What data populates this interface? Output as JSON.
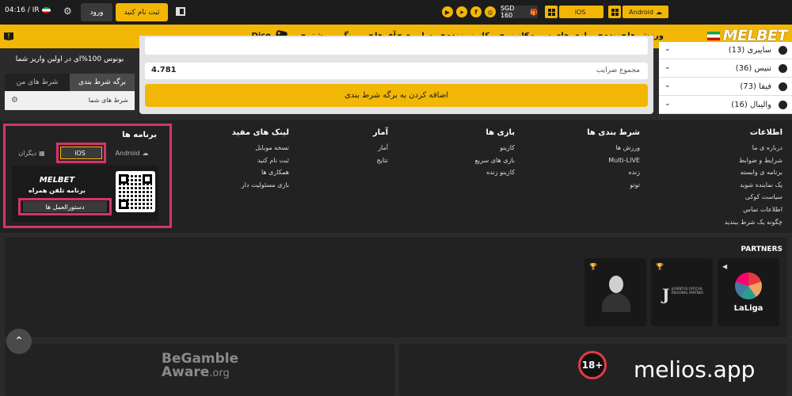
{
  "topbar": {
    "time": "04:16 / IR",
    "login": "ورود",
    "register": "ثبت نام کنید",
    "balance": "SGD 160",
    "ios": "iOS",
    "android": "Android",
    "social_icons": [
      "youtube-icon",
      "telegram-icon",
      "facebook-icon",
      "instagram-icon"
    ]
  },
  "nav": {
    "logo": "MELBET",
    "items": [
      "ورزش ها",
      "زنده",
      "بازی های سریع",
      "کازینو",
      "کازینو زنده",
      "سایبری",
      "آفرها",
      "بینگو",
      "بیشتر",
      "Dice"
    ]
  },
  "left": {
    "bonus": "بونوس 100%ای در اولین واریز شما",
    "tab_slip": "برگه شرط بندی",
    "tab_mybets": "شرط های من",
    "your_bets": "شرط های شما"
  },
  "betslip": {
    "total_label": "مجموع ضرایب",
    "total_value": "4.781",
    "add_button": "اضافه کردن به برگه شرط بندی"
  },
  "sports": [
    {
      "name": "سایبری (13)"
    },
    {
      "name": "تنیس (36)"
    },
    {
      "name": "فیفا (73)"
    },
    {
      "name": "والیبال (16)"
    }
  ],
  "footer": {
    "info": {
      "title": "اطلاعات",
      "items": [
        "درباره ی ما",
        "شرایط و ضوابط",
        "برنامه ی وابسته",
        "یک نماینده شوید",
        "سیاست کوکی",
        "اطلاعات تماس",
        "چگونه یک شرط ببندید"
      ]
    },
    "betting": {
      "title": "شرط بندی ها",
      "items": [
        "ورزش ها",
        "Multi-LIVE",
        "زنده",
        "توتو"
      ]
    },
    "games": {
      "title": "بازی ها",
      "items": [
        "کازینو",
        "بازی های سریع",
        "کازینو زنده"
      ]
    },
    "stats": {
      "title": "آمار",
      "items": [
        "آمار",
        "نتایج"
      ]
    },
    "useful": {
      "title": "لینک های مفید",
      "items": [
        "نسخه موبایل",
        "ثبت نام کنید",
        "همکاری ها",
        "بازی مسئولیت دار"
      ]
    },
    "apps": {
      "title": "برنامه ها",
      "android": "Android",
      "ios": "iOS",
      "others": "دیگران",
      "brand": "MELBET",
      "subtitle": "برنامه تلفن همراه",
      "instructions": "دستورالعمل ها"
    }
  },
  "partners": {
    "title": "PARTNERS",
    "laliga": "LaLiga",
    "juve_text": "JUVENTUS OFFICIAL REGIONAL PARTNER"
  },
  "bottom": {
    "begamble_1": "BeGamble",
    "begamble_2": "Aware",
    "begamble_org": ".org",
    "age": "18+",
    "watermark": "melios.app"
  },
  "colors": {
    "accent": "#f2b705",
    "highlight": "#d6336c",
    "dark": "#1c1c1c"
  }
}
